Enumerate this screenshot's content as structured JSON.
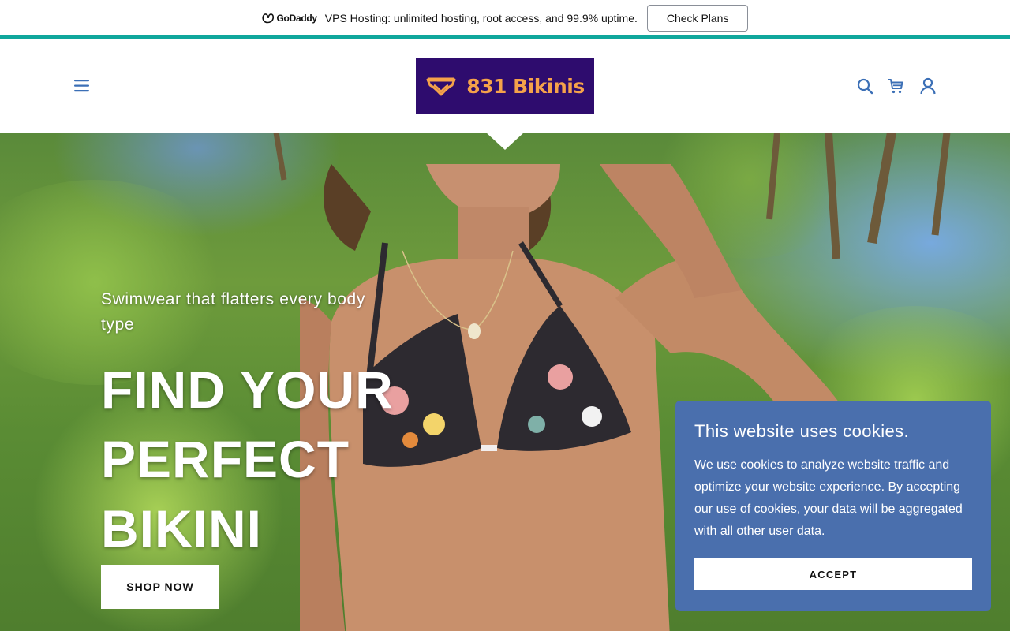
{
  "promo": {
    "brand": "GoDaddy",
    "text": "VPS Hosting: unlimited hosting, root access, and 99.9% uptime.",
    "button_label": "Check Plans"
  },
  "header": {
    "logo_text": "831 Bikinis",
    "icons": [
      "menu-icon",
      "search-icon",
      "cart-icon",
      "account-icon"
    ],
    "colors": {
      "icon": "#3b6fb6",
      "logo_bg": "#2e0c6e",
      "logo_text": "#f5a24a",
      "accent_line": "#0fa79c"
    }
  },
  "hero": {
    "tagline": "Swimwear that flatters every body type",
    "title_lines": [
      "FIND YOUR",
      "PERFECT",
      "BIKINI"
    ],
    "button_label": "SHOP NOW"
  },
  "cookie": {
    "title": "This website uses cookies.",
    "body": "We use cookies to analyze website traffic and optimize your website experience. By accepting our use of cookies, your data will be aggregated with all other user data.",
    "button_label": "ACCEPT",
    "bg_color": "#4a6fad"
  }
}
